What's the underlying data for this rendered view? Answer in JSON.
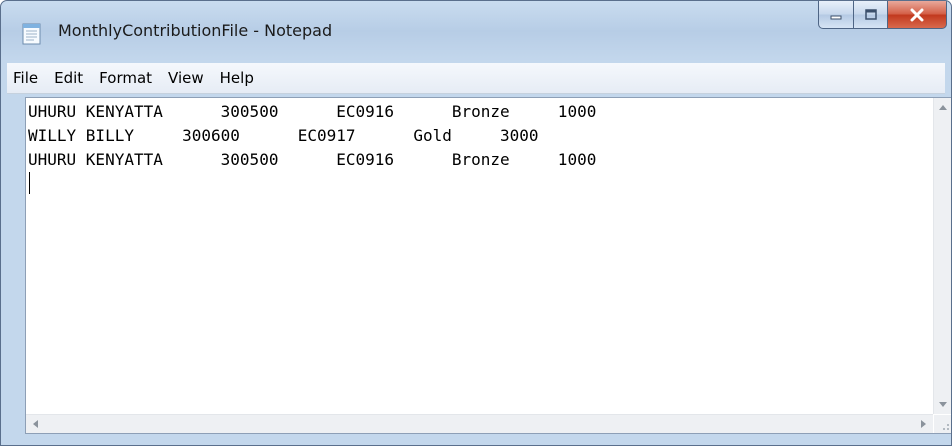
{
  "window": {
    "title": "MonthlyContributionFile - Notepad",
    "app_icon": "notepad-icon"
  },
  "caption_buttons": [
    {
      "name": "minimize",
      "icon": "minimize-icon"
    },
    {
      "name": "maximize",
      "icon": "maximize-icon"
    },
    {
      "name": "close",
      "icon": "close-icon"
    }
  ],
  "menu": {
    "items": [
      "File",
      "Edit",
      "Format",
      "View",
      "Help"
    ]
  },
  "editor": {
    "lines": [
      "UHURU KENYATTA      300500      EC0916      Bronze     1000",
      "WILLY BILLY     300600      EC0917      Gold     3000",
      "UHURU KENYATTA      300500      EC0916      Bronze     1000",
      ""
    ]
  },
  "colors": {
    "close_button": "#c1381d",
    "frame": "#b7cde6"
  }
}
